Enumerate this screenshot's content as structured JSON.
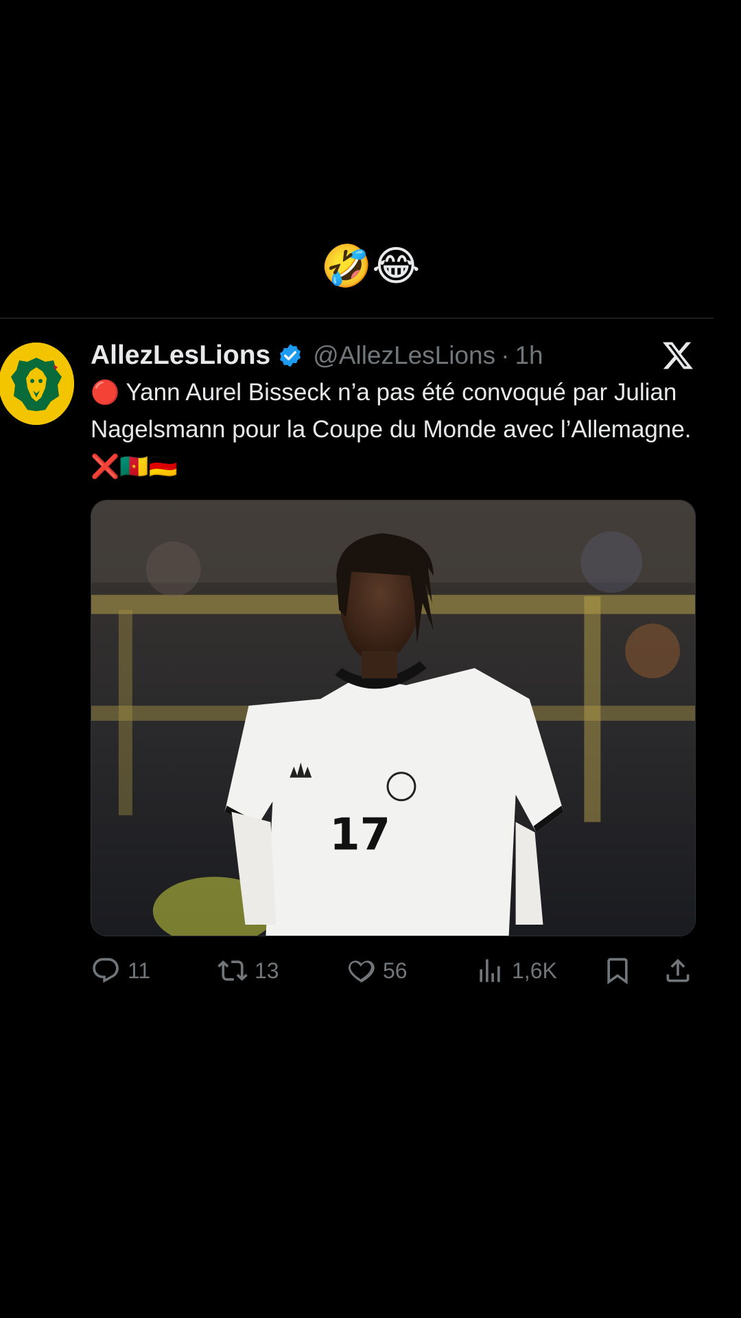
{
  "caption": "🤣😂",
  "tweet": {
    "display_name": "AllezLesLions",
    "handle": "@AllezLesLions",
    "separator": "·",
    "time": "1h",
    "text_emoji": "🔴",
    "text": " Yann Aurel Bisseck n’a pas été convoqué par Julian Nagelsmann pour la Coupe du Monde avec l’Allemagne. ",
    "text_trailing_emoji": "❌🇨🇲🇩🇪",
    "media_alt": "Football player in white jersey number 17",
    "jersey_number": "17"
  },
  "actions": {
    "replies": "11",
    "reposts": "13",
    "likes": "56",
    "views": "1,6K"
  },
  "colors": {
    "background": "#000000",
    "text": "#e7e9ea",
    "muted": "#71767b",
    "verified": "#1d9bf0",
    "avatar": "#f3c400"
  },
  "icons": {
    "avatar": "lion-logo-icon",
    "verified": "verified-badge-icon",
    "platform": "x-logo-icon",
    "reply": "reply-icon",
    "repost": "repost-icon",
    "like": "heart-icon",
    "views": "views-icon",
    "bookmark": "bookmark-icon",
    "share": "share-icon"
  }
}
